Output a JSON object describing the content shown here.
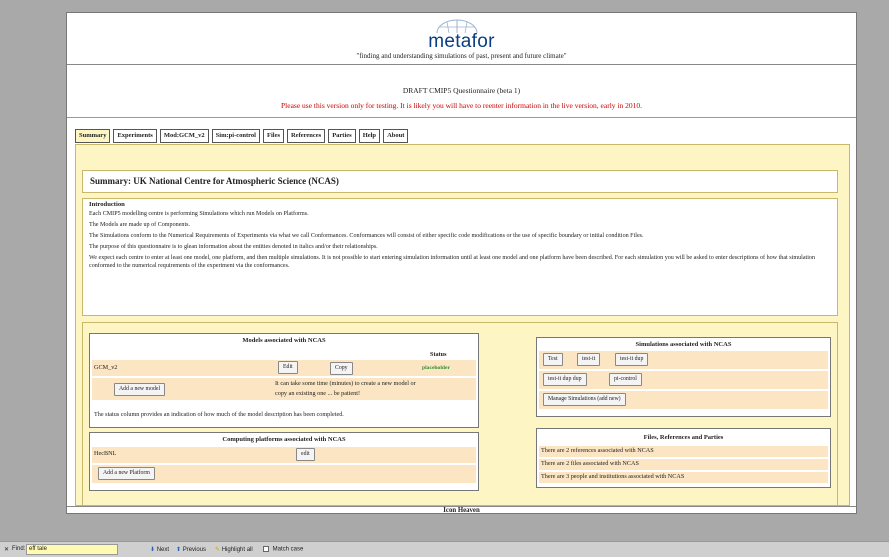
{
  "header": {
    "logo_text": "metafor",
    "tagline": "\"finding and understanding simulations of past, present and future climate\""
  },
  "notice": {
    "draft": "DRAFT CMIP5 Questionnaire (beta 1)",
    "warning": "Please use this version only for testing. It is likely you will have to reenter information in the live version, early in 2010."
  },
  "tabs": [
    {
      "label": "Summary"
    },
    {
      "label": "Experiments"
    },
    {
      "label": "Mod:GCM_v2"
    },
    {
      "label": "Sim:pi-control"
    },
    {
      "label": "Files"
    },
    {
      "label": "References"
    },
    {
      "label": "Parties"
    },
    {
      "label": "Help"
    },
    {
      "label": "About"
    }
  ],
  "summary": {
    "title": "Summary: UK National Centre for Atmospheric Science (NCAS)"
  },
  "intro": {
    "heading": "Introduction",
    "p1": "Each CMIP5 modelling centre is performing Simulations which run Models on Platforms.",
    "p2": "The Models are made up of Components.",
    "p3": "The Simulations conform to the Numerical Requirements of Experiments via what we call Conformances. Conformances will consist of either specific code modifications or the use of specific boundary or initial condition Files.",
    "p4": "The purpose of this questionnaire is to glean information about the entities denoted in italics and/or their relationships.",
    "p5": "We expect each centre to enter at least one model, one platform, and then multiple simulations. It is not possible to start entering simulation information until at least one model and one platform have been described. For each simulation you will be asked to enter descriptions of how that simulation conformed to the numerical requirements of the experiment via the conformances."
  },
  "models": {
    "title": "Models associated with NCAS",
    "status_header": "Status",
    "model_name": "GCM_v2",
    "edit_label": "Edit",
    "copy_label": "Copy",
    "status_value": "placeholder",
    "add_label": "Add a new model",
    "wait_note_1": "It can take some time (minutes) to create a new model or",
    "wait_note_2": "copy an existing one ... be patient!",
    "status_note": "The status column provides an indication of how much of the model description has been completed."
  },
  "platforms": {
    "title": "Computing platforms associated with NCAS",
    "platform_name": "HecBNL",
    "edit_label": "edit",
    "add_label": "Add a new Platform"
  },
  "simulations": {
    "title": "Simulations associated with NCAS",
    "buttons": [
      "Test",
      "test-it",
      "test-it dup",
      "test-it dup dup",
      "pi-control"
    ],
    "manage_label": "Manage Simulations (add new)"
  },
  "files": {
    "title": "Files, References and Parties",
    "lines": [
      "There are 2 references associated with NCAS",
      "There are 2 files associated with NCAS",
      "There are 3 people and institutions associated with NCAS"
    ]
  },
  "footer": {
    "label": "Icon Heaven"
  },
  "findbar": {
    "close": "✕",
    "find_label": "Find:",
    "find_value": "eff tale",
    "next_label": "Next",
    "previous_label": "Previous",
    "highlight_label": "Highlight all",
    "match_case_label": "Match case"
  },
  "colors": {
    "accent_red": "#cc0000",
    "panel_bg": "#fdf6c4",
    "row_band": "#fce5c3",
    "logo_blue": "#0a3d80",
    "status_green": "#2f8f2f"
  }
}
